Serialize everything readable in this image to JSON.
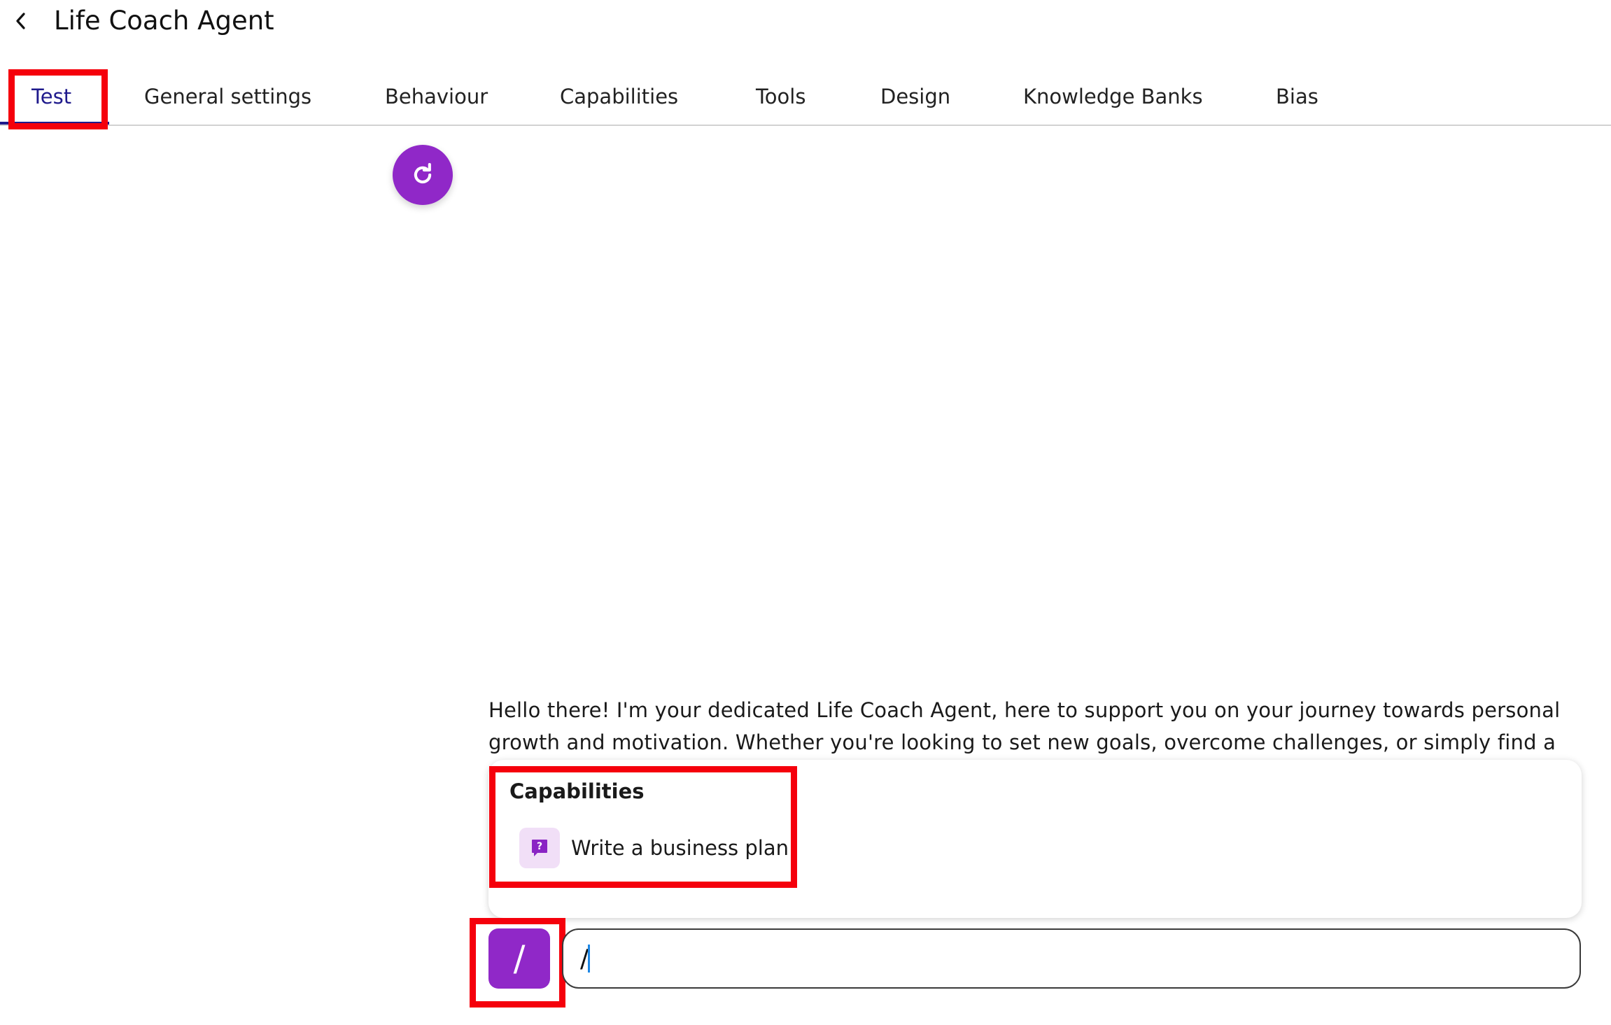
{
  "header": {
    "back_icon": "chevron-left-icon",
    "title": "Life Coach Agent"
  },
  "tabs": [
    {
      "label": "Test",
      "active": true
    },
    {
      "label": "General settings",
      "active": false
    },
    {
      "label": "Behaviour",
      "active": false
    },
    {
      "label": "Capabilities",
      "active": false
    },
    {
      "label": "Tools",
      "active": false
    },
    {
      "label": "Design",
      "active": false
    },
    {
      "label": "Knowledge Banks",
      "active": false
    },
    {
      "label": "Bias",
      "active": false
    }
  ],
  "chat": {
    "refresh_icon": "refresh-icon",
    "message": "Hello there! I'm your dedicated Life Coach Agent, here to support you on your journey towards personal growth and motivation. Whether you're looking to set new goals, overcome challenges, or simply find a",
    "capabilities": {
      "title": "Capabilities",
      "items": [
        {
          "label": "Write a business plan",
          "icon": "question-bubble-icon"
        }
      ]
    },
    "slash_button_label": "/",
    "input_value": "/"
  },
  "colors": {
    "accent_purple": "#9028c8",
    "active_tab": "#1f1a8c",
    "highlight_red": "#f5000c",
    "caret_blue": "#1e88e5"
  }
}
